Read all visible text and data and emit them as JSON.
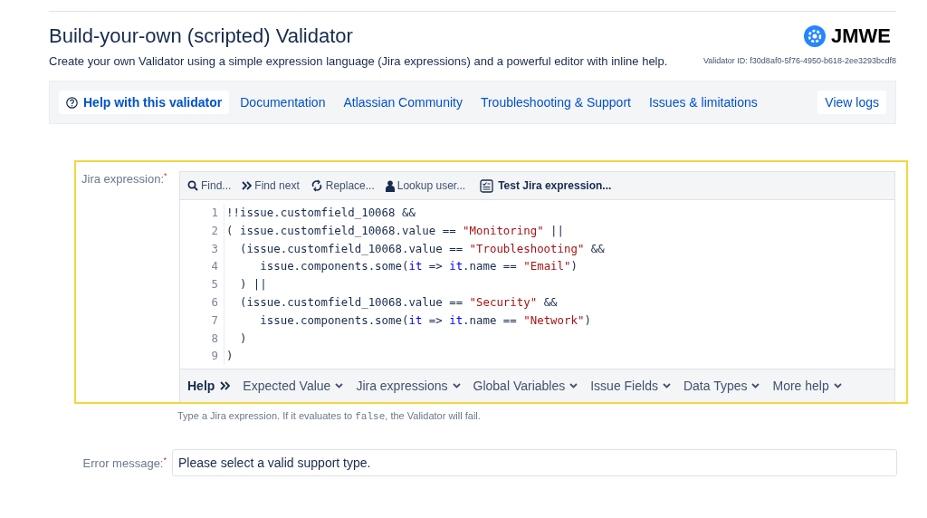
{
  "header": {
    "title": "Build-your-own (scripted) Validator",
    "description": "Create your own Validator using a simple expression language (Jira expressions) and a powerful editor with inline help.",
    "logo_text": "JMWE",
    "validator_id": "Validator ID: f30d8af0-5f76-4950-b618-2ee3293bcdf8"
  },
  "nav": [
    {
      "label": "Help with this validator",
      "kind": "help",
      "selected": true
    },
    {
      "label": "Documentation",
      "kind": "link",
      "selected": false
    },
    {
      "label": "Atlassian Community",
      "kind": "link",
      "selected": false
    },
    {
      "label": "Troubleshooting & Support",
      "kind": "link",
      "selected": false
    },
    {
      "label": "Issues & limitations",
      "kind": "link",
      "selected": false
    },
    {
      "label": "View logs",
      "kind": "button",
      "selected": false
    }
  ],
  "expression_field": {
    "label": "Jira expression:",
    "required_mark": "*",
    "toolbar": [
      {
        "label": "Find...",
        "kind": "search"
      },
      {
        "label": "Find next",
        "kind": "chevrons"
      },
      {
        "label": "Replace...",
        "kind": "replace"
      },
      {
        "label": "Lookup user...",
        "kind": "user"
      },
      {
        "label": "Test Jira expression...",
        "kind": "test"
      }
    ],
    "lines": [
      {
        "number": "1",
        "tokens": [
          {
            "kind": "plain",
            "text": "!!issue.customfield_10068 &&"
          }
        ]
      },
      {
        "number": "2",
        "tokens": [
          {
            "kind": "plain",
            "text": "( issue.customfield_10068.value == "
          },
          {
            "kind": "string",
            "text": "\"Monitoring\""
          },
          {
            "kind": "plain",
            "text": " ||"
          }
        ]
      },
      {
        "number": "3",
        "tokens": [
          {
            "kind": "plain",
            "text": "  (issue.customfield_10068.value == "
          },
          {
            "kind": "string",
            "text": "\"Troubleshooting\""
          },
          {
            "kind": "plain",
            "text": " &&"
          }
        ]
      },
      {
        "number": "4",
        "tokens": [
          {
            "kind": "plain",
            "text": "     issue.components.some("
          },
          {
            "kind": "variable",
            "text": "it"
          },
          {
            "kind": "plain",
            "text": " => "
          },
          {
            "kind": "variable",
            "text": "it"
          },
          {
            "kind": "plain",
            "text": ".name == "
          },
          {
            "kind": "string",
            "text": "\"Email\""
          },
          {
            "kind": "plain",
            "text": ")"
          }
        ]
      },
      {
        "number": "5",
        "tokens": [
          {
            "kind": "plain",
            "text": "  ) ||"
          }
        ]
      },
      {
        "number": "6",
        "tokens": [
          {
            "kind": "plain",
            "text": "  (issue.customfield_10068.value == "
          },
          {
            "kind": "string",
            "text": "\"Security\""
          },
          {
            "kind": "plain",
            "text": " &&"
          }
        ]
      },
      {
        "number": "7",
        "tokens": [
          {
            "kind": "plain",
            "text": "     issue.components.some("
          },
          {
            "kind": "variable",
            "text": "it"
          },
          {
            "kind": "plain",
            "text": " => "
          },
          {
            "kind": "variable",
            "text": "it"
          },
          {
            "kind": "plain",
            "text": ".name == "
          },
          {
            "kind": "string",
            "text": "\"Network\""
          },
          {
            "kind": "plain",
            "text": ")"
          }
        ]
      },
      {
        "number": "8",
        "tokens": [
          {
            "kind": "plain",
            "text": "  )"
          }
        ]
      },
      {
        "number": "9",
        "tokens": [
          {
            "kind": "plain",
            "text": ")"
          }
        ]
      }
    ],
    "help_bar": {
      "title": "Help",
      "menus": [
        "Expected Value",
        "Jira expressions",
        "Global Variables",
        "Issue Fields",
        "Data Types",
        "More help"
      ]
    },
    "hint": [
      {
        "kind": "text",
        "text": "Type a Jira expression. If it evaluates to "
      },
      {
        "kind": "code",
        "text": "false"
      },
      {
        "kind": "text",
        "text": ", the Validator will fail."
      }
    ]
  },
  "error_field": {
    "label": "Error message:",
    "required_mark": "*",
    "value": "Please select a valid support type."
  }
}
